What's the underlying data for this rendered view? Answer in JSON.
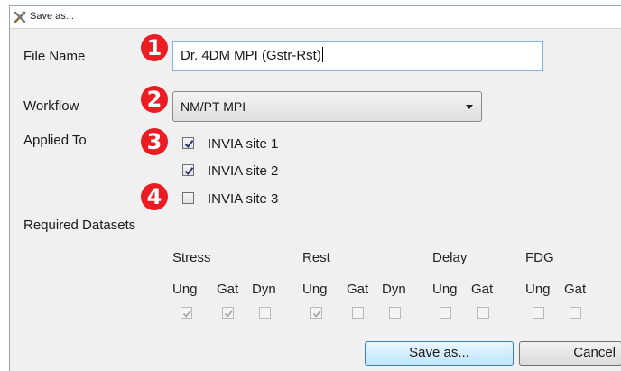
{
  "window": {
    "title": "Save as...",
    "icon": "tools-icon"
  },
  "file_name": {
    "label": "File Name",
    "value": "Dr. 4DM MPI (Gstr-Rst)",
    "badge": "1"
  },
  "workflow": {
    "label": "Workflow",
    "selected": "NM/PT MPI",
    "badge": "2"
  },
  "applied_to": {
    "label": "Applied To",
    "badge": "3",
    "badge2": "4",
    "sites": [
      {
        "label": "INVIA site 1",
        "checked": true
      },
      {
        "label": "INVIA site 2",
        "checked": true
      },
      {
        "label": "INVIA site 3",
        "checked": false
      }
    ]
  },
  "required_datasets": {
    "label": "Required Datasets",
    "groups": [
      {
        "name": "Stress",
        "items": [
          {
            "label": "Ung",
            "checked": true
          },
          {
            "label": "Gat",
            "checked": true
          },
          {
            "label": "Dyn",
            "checked": false
          }
        ]
      },
      {
        "name": "Rest",
        "items": [
          {
            "label": "Ung",
            "checked": true
          },
          {
            "label": "Gat",
            "checked": false
          },
          {
            "label": "Dyn",
            "checked": false
          }
        ]
      },
      {
        "name": "Delay",
        "items": [
          {
            "label": "Ung",
            "checked": false
          },
          {
            "label": "Gat",
            "checked": false
          }
        ]
      },
      {
        "name": "FDG",
        "items": [
          {
            "label": "Ung",
            "checked": false
          },
          {
            "label": "Gat",
            "checked": false
          }
        ]
      }
    ]
  },
  "buttons": {
    "save": "Save as...",
    "cancel": "Cancel"
  },
  "colors": {
    "badge": "#ec1c24",
    "check_enabled": "#27336f",
    "check_disabled": "#a9a9a9",
    "focus_border": "#7eb4ea"
  }
}
